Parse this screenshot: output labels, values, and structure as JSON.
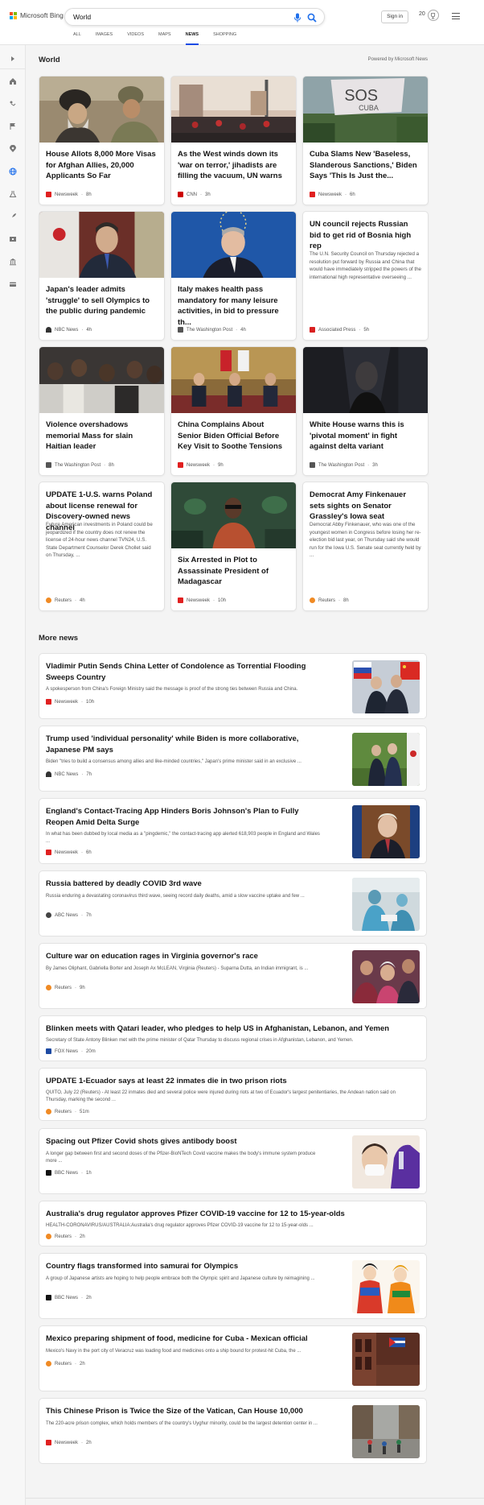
{
  "header": {
    "brand": "Microsoft Bing",
    "search_value": "World",
    "signin": "Sign in",
    "points": "20",
    "tabs": [
      "ALL",
      "IMAGES",
      "VIDEOS",
      "MAPS",
      "NEWS",
      "SHOPPING"
    ],
    "active_tab": "NEWS"
  },
  "rail": {
    "icons": [
      "expand-icon",
      "home-icon",
      "sports-icon",
      "flag-icon",
      "location-icon",
      "globe-icon",
      "science-icon",
      "rocket-icon",
      "film-icon",
      "bank-icon",
      "card-icon"
    ],
    "active": "globe-icon"
  },
  "section": {
    "title": "World",
    "powered": "Powered by Microsoft News"
  },
  "cards": [
    {
      "title": "House Allots 8,000 More Visas for Afghan Allies, 20,000 Applicants So Far",
      "source": "Newsweek",
      "age": "8h",
      "icon_color": "#e02020"
    },
    {
      "title": "As the West winds down its 'war on terror,' jihadists are filling the vacuum, UN warns",
      "source": "CNN",
      "age": "3h",
      "icon_color": "#cc0000"
    },
    {
      "title": "Cuba Slams New 'Baseless, Slanderous Sanctions,' Biden Says 'This Is Just the...",
      "source": "Newsweek",
      "age": "6h",
      "icon_color": "#e02020"
    },
    {
      "title": "Japan's leader admits 'struggle' to sell Olympics to the public during pandemic",
      "source": "NBC News",
      "age": "4h",
      "icon_color": "#333333"
    },
    {
      "title": "Italy makes health pass mandatory for many leisure activities, in bid to pressure th...",
      "source": "The Washington Post",
      "age": "4h",
      "icon_color": "#555555"
    },
    {
      "title": "UN council rejects Russian bid to get rid of Bosnia high rep",
      "snippet": "The U.N. Security Council on Thursday rejected a resolution put forward by Russia and China that would have immediately stripped the powers of the international high representative overseeing ...",
      "source": "Associated Press",
      "age": "5h",
      "icon_color": "#d92020"
    },
    {
      "title": "Violence overshadows memorial Mass for slain Haitian leader",
      "source": "The Washington Post",
      "age": "8h",
      "icon_color": "#555555"
    },
    {
      "title": "China Complains About Senior Biden Official Before Key Visit to Soothe Tensions",
      "source": "Newsweek",
      "age": "9h",
      "icon_color": "#e02020"
    },
    {
      "title": "White House warns this is 'pivotal moment' in fight against delta variant",
      "source": "The Washington Post",
      "age": "3h",
      "icon_color": "#555555"
    },
    {
      "title": "UPDATE 1-U.S. warns Poland about license renewal for Discovery-owned news channel",
      "snippet": "Future American investments in Poland could be jeopardized if the country does not renew the license of 24-hour news channel TVN24, U.S. State Department Counselor Derek Chollet said on Thursday, ...",
      "source": "Reuters",
      "age": "4h",
      "icon_color": "#f08a24"
    },
    {
      "title": "Six Arrested in Plot to Assassinate President of Madagascar",
      "source": "Newsweek",
      "age": "10h",
      "icon_color": "#e02020"
    },
    {
      "title": "Democrat Amy Finkenauer sets sights on Senator Grassley's Iowa seat",
      "snippet": "Democrat Abby Finkenauer, who was one of the youngest women in Congress before losing her re-election bid last year, on Thursday said she would run for the Iowa U.S. Senate seat currently held by ...",
      "source": "Reuters",
      "age": "8h",
      "icon_color": "#f08a24"
    }
  ],
  "more_news": {
    "title": "More news",
    "items": [
      {
        "title": "Vladimir Putin Sends China Letter of Condolence as Torrential Flooding Sweeps Country",
        "snippet": "A spokesperson from China's Foreign Ministry said the message is proof of the strong ties between Russia and China.",
        "source": "Newsweek",
        "age": "10h",
        "icon_color": "#e02020"
      },
      {
        "title": "Trump used 'individual personality' while Biden is more collaborative, Japanese PM says",
        "snippet": "Biden \"tries to build a consensus among allies and like-minded countries,\" Japan's prime minister said in an exclusive ...",
        "source": "NBC News",
        "age": "7h",
        "icon_color": "#333333"
      },
      {
        "title": "England's Contact-Tracing App Hinders Boris Johnson's Plan to Fully Reopen Amid Delta Surge",
        "snippet": "In what has been dubbed by local media as a \"pingdemic,\" the contact-tracing app alerted 618,903 people in England and Wales ...",
        "source": "Newsweek",
        "age": "6h",
        "icon_color": "#e02020"
      },
      {
        "title": "Russia battered by deadly COVID 3rd wave",
        "snippet": "Russia enduring a devastating coronavirus third wave, seeing record daily deaths, amid a slow vaccine uptake and few ...",
        "source": "ABC News",
        "age": "7h",
        "icon_color": "#444444"
      },
      {
        "title": "Culture war on education rages in Virginia governor's race",
        "snippet": "By James Oliphant, Gabriella Borter and Joseph Ax McLEAN, Virginia (Reuters) - Suparna Dutta, an Indian immigrant, is ...",
        "source": "Reuters",
        "age": "9h",
        "icon_color": "#f08a24"
      },
      {
        "title": "Blinken meets with Qatari leader, who pledges to help US in Afghanistan, Lebanon, and Yemen",
        "snippet": "Secretary of State Antony Blinken met with the prime minister of Qatar Thursday to discuss regional crises in Afghanistan, Lebanon, and Yemen.",
        "source": "FOX News",
        "age": "20m",
        "icon_color": "#1d4aa3"
      },
      {
        "title": "UPDATE 1-Ecuador says at least 22 inmates die in two prison riots",
        "snippet": "QUITO, July 22 (Reuters) - At least 22 inmates died and several police were injured during riots at two of Ecuador's largest penitentiaries, the Andean nation said on Thursday, marking the second ...",
        "source": "Reuters",
        "age": "51m",
        "icon_color": "#f08a24"
      },
      {
        "title": "Spacing out Pfizer Covid shots gives antibody boost",
        "snippet": "A longer gap between first and second doses of the Pfizer-BioNTech Covid vaccine makes the body's immune system produce more ...",
        "source": "BBC News",
        "age": "1h",
        "icon_color": "#111111"
      },
      {
        "title": "Australia's drug regulator approves Pfizer COVID-19 vaccine for 12 to 15-year-olds",
        "snippet": "HEALTH-CORONAVIRUS/AUSTRALIA:Australia's drug regulator approves Pfizer COVID-19 vaccine for 12 to 15-year-olds ...",
        "source": "Reuters",
        "age": "2h",
        "icon_color": "#f08a24"
      },
      {
        "title": "Country flags transformed into samurai for Olympics",
        "snippet": "A group of Japanese artists are hoping to help people embrace both the Olympic spirit and Japanese culture by reimagining ...",
        "source": "BBC News",
        "age": "2h",
        "icon_color": "#111111"
      },
      {
        "title": "Mexico preparing shipment of food, medicine for Cuba - Mexican official",
        "snippet": "Mexico's Navy in the port city of Veracruz was loading food and medicines onto a ship bound for protest-hit Cuba, the ...",
        "source": "Reuters",
        "age": "2h",
        "icon_color": "#f08a24"
      },
      {
        "title": "This Chinese Prison is Twice the Size of the Vatican, Can House 10,000",
        "snippet": "The 220-acre prison complex, which holds members of the country's Uyghur minority, could be the largest detention center in ...",
        "source": "Newsweek",
        "age": "2h",
        "icon_color": "#e02020"
      }
    ]
  }
}
